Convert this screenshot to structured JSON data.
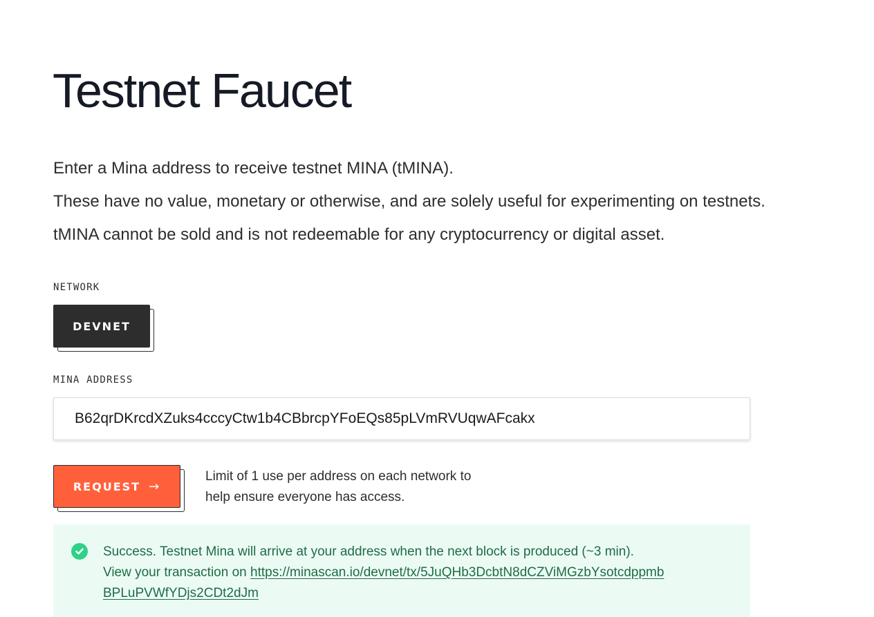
{
  "page": {
    "title": "Testnet Faucet",
    "description": [
      "Enter a Mina address to receive testnet MINA (tMINA).",
      "These have no value, monetary or otherwise, and are solely useful for experimenting on testnets.",
      "tMINA cannot be sold and is not redeemable for any cryptocurrency or digital asset."
    ]
  },
  "network": {
    "label": "NETWORK",
    "selected": "DEVNET"
  },
  "address": {
    "label": "MINA ADDRESS",
    "value": "B62qrDKrcdXZuks4cccyCtw1b4CBbrcpYFoEQs85pLVmRVUqwAFcakx"
  },
  "request": {
    "button_label": "REQUEST",
    "arrow": "→",
    "limit_note": [
      "Limit of 1 use per address on each network to",
      "help ensure everyone has access."
    ]
  },
  "success": {
    "message": "Success. Testnet Mina will arrive at your address when the next block is produced (~3 min).",
    "tx_prefix": "View your transaction on ",
    "tx_link_line1": "https://minascan.io/devnet/tx/5JuQHb3DcbtN8dCZViMGzbYsotcdppmb",
    "tx_link_line2": "BPLuPVWfYDjs2CDt2dJm"
  },
  "colors": {
    "accent": "#ff603b",
    "dark": "#2d2d2d",
    "success_bg": "#ebfbf3",
    "success_text": "#1f6b48",
    "success_icon": "#2fd188"
  },
  "icons": {
    "success": "check-circle-icon",
    "request": "arrow-right-icon"
  }
}
